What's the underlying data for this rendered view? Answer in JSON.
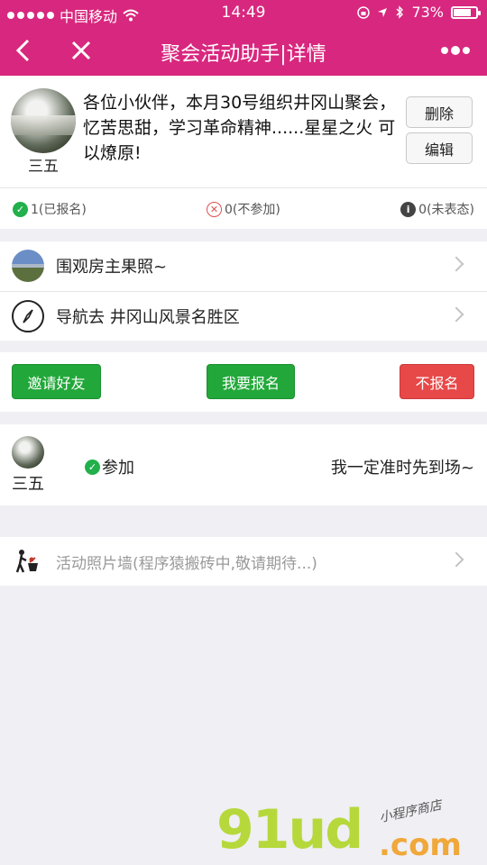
{
  "status_bar": {
    "carrier": "中国移动",
    "time": "14:49",
    "battery": "73%"
  },
  "nav": {
    "title": "聚会活动助手|详情"
  },
  "post": {
    "author": "三五",
    "text": "各位小伙伴，本月30号组织井冈山聚会，忆苦思甜，学习革命精神......星星之火 可以燎原!",
    "delete_label": "删除",
    "edit_label": "编辑"
  },
  "stats": {
    "joined": "1(已报名)",
    "declined": "0(不参加)",
    "undecided": "0(未表态)"
  },
  "links": {
    "photo_label": "围观房主果照~",
    "navigate_label": "导航去 井冈山风景名胜区"
  },
  "actions": {
    "invite": "邀请好友",
    "signup": "我要报名",
    "decline": "不报名"
  },
  "attendees": [
    {
      "name": "三五",
      "status": "参加",
      "comment": "我一定准时先到场~"
    }
  ],
  "photo_wall": {
    "label": "活动照片墙(程序猿搬砖中,敬请期待...)"
  },
  "watermark": {
    "main": "91ud",
    "domain": ".com",
    "sub": "小程序商店"
  },
  "colors": {
    "brand": "#d8277e",
    "green": "#22a83a",
    "red": "#e74848"
  }
}
